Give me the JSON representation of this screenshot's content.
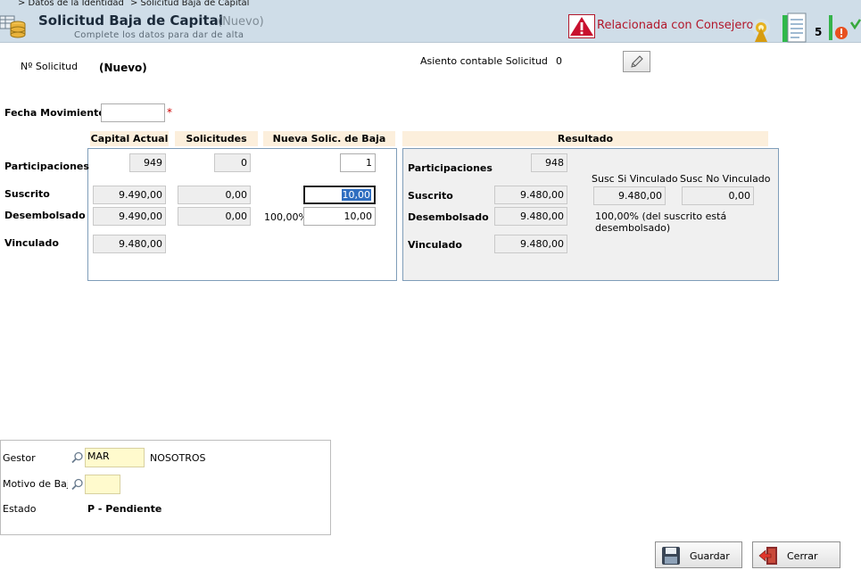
{
  "breadcrumb": [
    "> Datos de la Identidad",
    "> Solicitud Baja de Capital"
  ],
  "header": {
    "title": "Solicitud Baja de Capital",
    "status": "(Nuevo)",
    "subtitle": "Complete los datos para dar de alta",
    "warning": "Relacionada con Consejeros",
    "doc_count": "5"
  },
  "top": {
    "nsolicitud_label": "Nº Solicitud",
    "nsolicitud_value": "(Nuevo)",
    "asiento_label": "Asiento contable Solicitud",
    "asiento_value": "0"
  },
  "fecha": {
    "label": "Fecha Movimiento",
    "value": "",
    "required": "*"
  },
  "columns": {
    "capital_actual": "Capital Actual",
    "solicitudes": "Solicitudes",
    "nueva": "Nueva Solic. de Baja",
    "resultado": "Resultado"
  },
  "rows": {
    "participaciones": "Participaciones",
    "suscrito": "Suscrito",
    "desembolsado": "Desembolsado",
    "vinculado": "Vinculado"
  },
  "left_values": {
    "cap_participaciones": "949",
    "sol_participaciones": "0",
    "nueva_participaciones": "1",
    "cap_suscrito": "9.490,00",
    "sol_suscrito": "0,00",
    "nueva_suscrito": "10,00",
    "cap_desembolsado": "9.490,00",
    "sol_desembolsado": "0,00",
    "nueva_desembolsado_pct": "100,00%",
    "nueva_desembolsado": "10,00",
    "cap_vinculado": "9.480,00"
  },
  "result": {
    "participaciones": "948",
    "suscrito": "9.480,00",
    "desembolsado": "9.480,00",
    "vinculado": "9.480,00",
    "susc_si_label": "Susc Si Vinculado",
    "susc_no_label": "Susc No Vinculado",
    "susc_si_value": "9.480,00",
    "susc_no_value": "0,00",
    "desembolso_note_1": "100,00% (del suscrito está",
    "desembolso_note_2": "desembolsado)"
  },
  "bottom": {
    "gestor_label": "Gestor",
    "gestor_code": "MAR",
    "gestor_name": "NOSOTROS",
    "motivo_label": "Motivo de Baja",
    "motivo_value": "",
    "estado_label": "Estado",
    "estado_value": "P - Pendiente"
  },
  "buttons": {
    "guardar": "Guardar",
    "cerrar": "Cerrar"
  },
  "colors": {
    "header_bg": "#cfdde8",
    "column_header": "#fcefdc",
    "warning": "#b2182b",
    "required": "#cc0000",
    "lookup_field": "#fffacd"
  }
}
